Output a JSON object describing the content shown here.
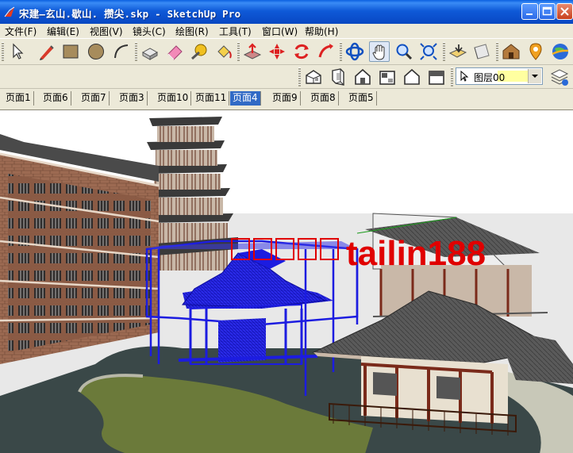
{
  "window": {
    "title": "宋建—玄山.歇山. 攒尖.skp - SketchUp Pro"
  },
  "menu": [
    {
      "label": "文件(F)"
    },
    {
      "label": "编辑(E)"
    },
    {
      "label": "视图(V)"
    },
    {
      "label": "镜头(C)"
    },
    {
      "label": "绘图(R)"
    },
    {
      "label": "工具(T)"
    },
    {
      "label": "窗口(W)"
    },
    {
      "label": "帮助(H)"
    }
  ],
  "toolbar": {
    "tools": [
      "select-arrow-icon",
      "pencil-icon",
      "rectangle-icon",
      "circle-icon",
      "arc-icon",
      "make-component-icon",
      "eraser-icon",
      "tape-measure-icon",
      "paint-bucket-icon",
      "push-pull-icon",
      "move-icon",
      "rotate-icon",
      "follow-me-icon",
      "orbit-icon",
      "pan-icon",
      "zoom-icon",
      "zoom-extents-icon",
      "offset-icon",
      "section-plane-icon",
      "warehouse-icon",
      "add-location-icon",
      "google-earth-icon"
    ],
    "views": [
      "iso-view-icon",
      "top-view-icon",
      "front-view-icon",
      "right-view-icon",
      "back-view-icon",
      "left-view-icon"
    ],
    "layer": {
      "name": "图层00",
      "color": "#ffffa0"
    }
  },
  "scenes": {
    "tabs": [
      {
        "label": "页面1",
        "active": false
      },
      {
        "label": "页面6",
        "active": false
      },
      {
        "label": "页面7",
        "active": false
      },
      {
        "label": "页面3",
        "active": false
      },
      {
        "label": "页面10",
        "active": false
      },
      {
        "label": "页面11",
        "active": false
      },
      {
        "label": "页面4",
        "active": true
      },
      {
        "label": "页面9",
        "active": false
      },
      {
        "label": "页面8",
        "active": false
      },
      {
        "label": "页面5",
        "active": false
      }
    ]
  },
  "viewport": {
    "watermark": "tailin188",
    "colors": {
      "selection": "#1c1ce0",
      "watermark": "#e00000",
      "sky": "#ffffff",
      "water": "#3a4a4a",
      "grass": "#6b7a3a"
    }
  }
}
